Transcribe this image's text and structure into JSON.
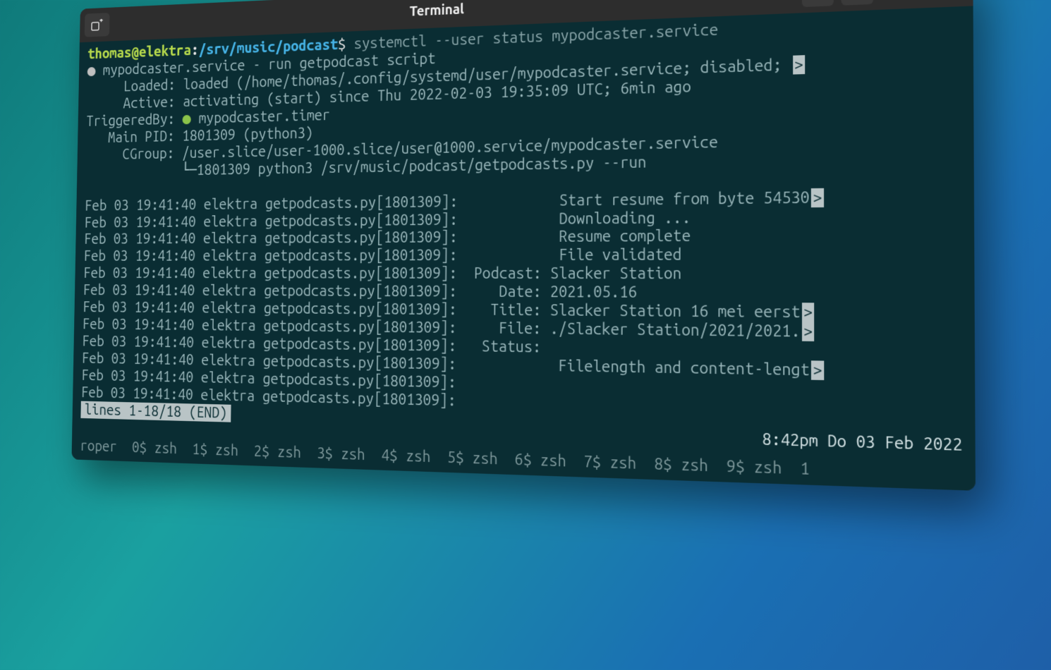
{
  "window": {
    "title": "Terminal"
  },
  "prompt": {
    "user_host": "thomas@elektra",
    "cwd": "/srv/music/podcast",
    "sigil": "$",
    "command": "systemctl --user status mypodcaster.service"
  },
  "service": {
    "header": "mypodcaster.service - run getpodcast script",
    "fields": {
      "loaded_label": "     Loaded: ",
      "loaded_value": "loaded (/home/thomas/.config/systemd/user/mypodcaster.service; disabled; ",
      "active_label": "     Active: ",
      "active_value": "activating (start) since Thu 2022-02-03 19:35:09 UTC; 6min ago",
      "triggered_label": "TriggeredBy: ",
      "triggered_value": " mypodcaster.timer",
      "mainpid_label": "   Main PID: ",
      "mainpid_value": "1801309 (python3)",
      "cgroup_label": "     CGroup: ",
      "cgroup_value": "/user.slice/user-1000.slice/user@1000.service/mypodcaster.service",
      "cgroup_child": "             └─1801309 python3 /srv/music/podcast/getpodcasts.py --run"
    }
  },
  "journal": {
    "prefix": "Feb 03 19:41:40 elektra getpodcasts.py[1801309]: ",
    "lines": [
      "           Start resume from byte 54530",
      "           Downloading ...",
      "           Resume complete",
      "           File validated",
      " Podcast: Slacker Station",
      "    Date: 2021.05.16",
      "   Title: Slacker Station 16 mei eerst",
      "    File: ./Slacker Station/2021/2021.",
      "  Status:",
      "           Filelength and content-lengt",
      "",
      ""
    ],
    "truncated_rows": [
      0,
      6,
      7,
      9
    ]
  },
  "pager": "lines 1-18/18 (END)",
  "status_clock": "8:42pm Do 03 Feb 2022",
  "tmux": {
    "session": "roper",
    "windows": [
      "0$ zsh",
      "1$ zsh",
      "2$ zsh",
      "3$ zsh",
      "4$ zsh",
      "5$ zsh",
      "6$ zsh",
      "7$ zsh",
      "8$ zsh",
      "9$ zsh"
    ],
    "tail": "  1"
  },
  "icons": {
    "new_tab": "new-tab",
    "search": "search",
    "menu": "menu",
    "minimize": "minimize",
    "maximize": "maximize",
    "close": "close"
  }
}
